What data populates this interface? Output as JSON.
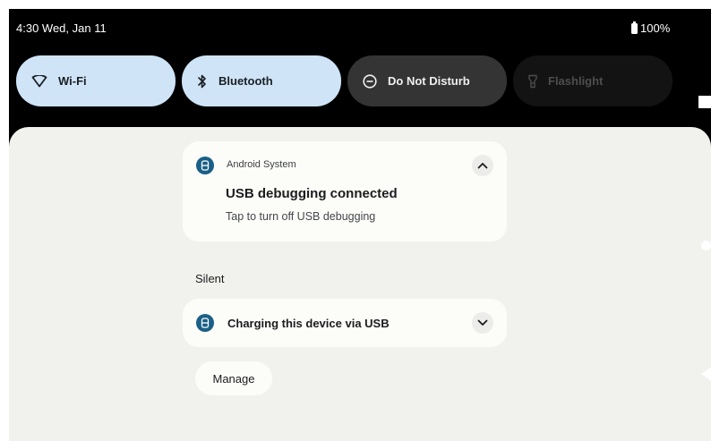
{
  "status_bar": {
    "time_date": "4:30 Wed, Jan 11",
    "battery": "100%"
  },
  "quick_settings": {
    "tiles": [
      {
        "label": "Wi-Fi",
        "icon": "wifi-icon",
        "state": "on"
      },
      {
        "label": "Bluetooth",
        "icon": "bluetooth-icon",
        "state": "on"
      },
      {
        "label": "Do Not Disturb",
        "icon": "do-not-disturb-icon",
        "state": "off"
      },
      {
        "label": "Flashlight",
        "icon": "flashlight-icon",
        "state": "unavailable"
      }
    ]
  },
  "notifications": {
    "usb_debugging": {
      "app_name": "Android System",
      "title": "USB debugging connected",
      "text": "Tap to turn off USB debugging",
      "expanded": true
    },
    "silent_section": {
      "label": "Silent",
      "items": [
        {
          "title": "Charging this device via USB",
          "expanded": false
        }
      ]
    },
    "manage_label": "Manage"
  },
  "colors": {
    "tile_on": "#cfe4f7",
    "tile_dnd": "#343434",
    "shade_background": "#f1f2ee",
    "card_background": "#fcfcf9",
    "app_icon": "#1a5f87"
  }
}
